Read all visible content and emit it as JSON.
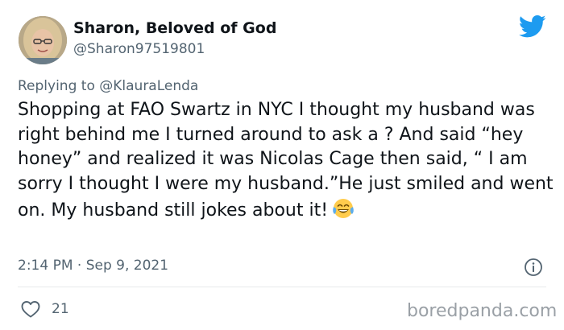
{
  "author": {
    "display_name": "Sharon, Beloved of God",
    "handle": "@Sharon97519801"
  },
  "reply": {
    "prefix": "Replying to ",
    "to_handle": "@KlauraLenda"
  },
  "tweet": {
    "text": "Shopping at FAO Swartz in NYC I thought my husband was right behind me I turned around to ask a ? And said “hey honey” and realized it was Nicolas Cage then said, “ I am sorry I thought I were my husband.”He just smiled and went on. My husband still jokes about it!",
    "emoji": "tears-of-joy-emoji"
  },
  "meta": {
    "time": "2:14 PM",
    "separator": " · ",
    "date": "Sep 9, 2021"
  },
  "stats": {
    "likes": "21"
  },
  "watermark": "boredpanda.com",
  "colors": {
    "twitter_blue": "#1d9bf0",
    "secondary_text": "#536471",
    "primary_text": "#0f1419",
    "divider": "#e6e9eb"
  },
  "icons": {
    "brand": "twitter-bird-icon",
    "info": "info-icon",
    "like": "heart-icon"
  }
}
